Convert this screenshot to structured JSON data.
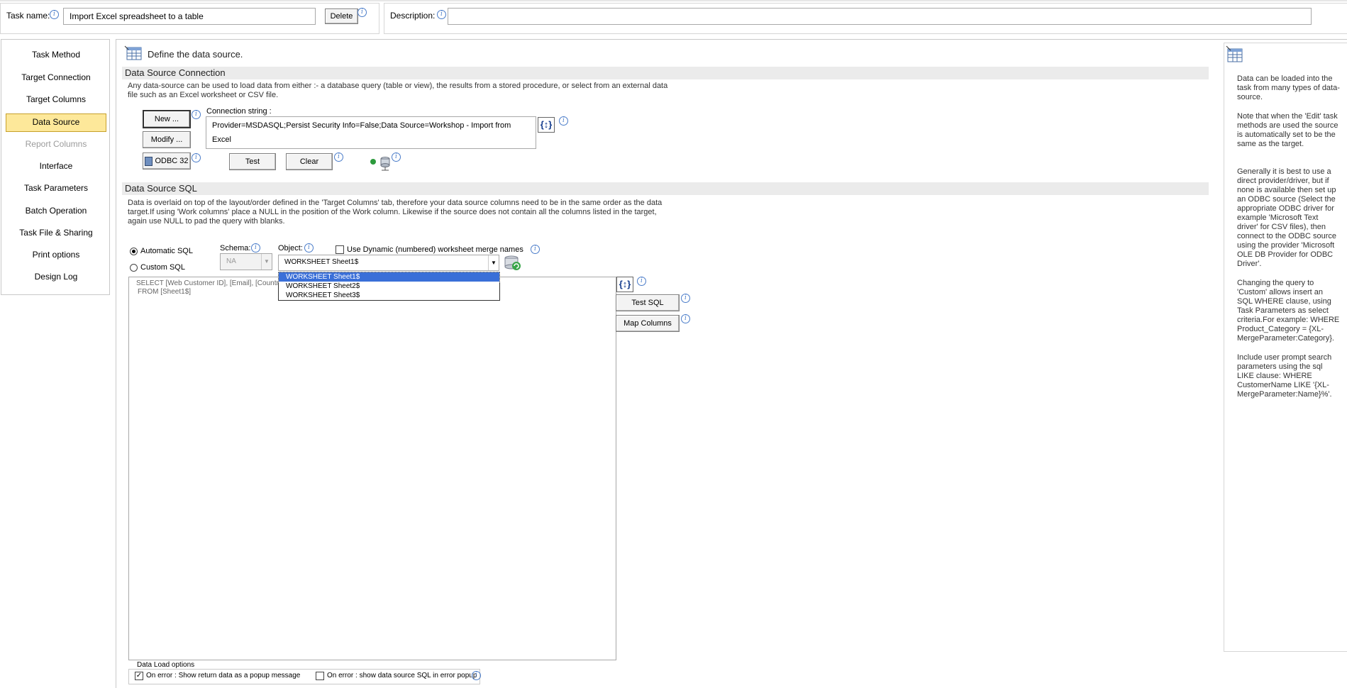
{
  "header": {
    "task_name_label": "Task name:",
    "task_name_value": "Import Excel spreadsheet to a table",
    "delete_label": "Delete",
    "description_label": "Description:",
    "description_value": ""
  },
  "nav": {
    "items": [
      {
        "label": "Task Method"
      },
      {
        "label": "Target Connection"
      },
      {
        "label": "Target Columns"
      },
      {
        "label": "Data Source"
      },
      {
        "label": "Report Columns"
      },
      {
        "label": "Interface"
      },
      {
        "label": "Task Parameters"
      },
      {
        "label": "Batch Operation"
      },
      {
        "label": "Task File & Sharing"
      },
      {
        "label": "Print options"
      },
      {
        "label": "Design Log"
      }
    ]
  },
  "main": {
    "heading": "Define the data source.",
    "connection": {
      "section_title": "Data Source Connection",
      "description_line1": "Any data-source can be used to load data from either :- a database query (table or view), the results from a stored procedure, or select from an external data",
      "description_line2": "file such as an Excel worksheet or CSV file.",
      "new_label": "New ...",
      "modify_label": "Modify ...",
      "odbc_label": "ODBC 32",
      "conn_string_label": "Connection string :",
      "conn_string_value": "Provider=MSDASQL;Persist Security Info=False;Data Source=Workshop - Import from Excel",
      "test_label": "Test",
      "clear_label": "Clear",
      "param_button": "{↕}"
    },
    "sql": {
      "section_title": "Data Source SQL",
      "description_line1": "Data is overlaid on top of the layout/order defined in the 'Target Columns' tab,  therefore your data source columns need to be in the same order as the data",
      "description_line2": "target.If using 'Work columns' place a NULL in the position of the Work column.  Likewise if the source does not contain all the columns listed in the target,",
      "description_line3": "again use NULL to pad the query with blanks.",
      "automatic_label": "Automatic SQL",
      "custom_label": "Custom SQL",
      "schema_label": "Schema:",
      "schema_value": "NA",
      "object_label": "Object:",
      "object_value": "WORKSHEET Sheet1$",
      "dynamic_label": "Use Dynamic (numbered) worksheet merge names",
      "dropdown_options": [
        "WORKSHEET Sheet1$",
        "WORKSHEET Sheet2$",
        "WORKSHEET Sheet3$"
      ],
      "sql_line1": "SELECT [Web Customer ID], [Email], [Country], [",
      "sql_line2": "FROM [Sheet1$]",
      "test_sql_label": "Test SQL",
      "map_columns_label": "Map Columns",
      "param_button": "{↕}"
    },
    "load_options": {
      "group_label": "Data Load options",
      "opt1_label": "On error : Show return data as a popup message",
      "opt1_checked": true,
      "opt2_label": "On error : show data source SQL in error popup",
      "opt2_checked": false
    }
  },
  "help": {
    "paragraphs": [
      "Data can be loaded into the task from many types of data-source.",
      "Note that when the 'Edit' task methods are used the source is automatically set to be the same as the target.",
      "Generally it is best to use a direct provider/driver, but if none is available then set up an ODBC source (Select the appropriate ODBC driver for example 'Microsoft Text driver' for CSV files), then connect to the ODBC source using the provider 'Microsoft OLE DB Provider for ODBC Driver'.",
      "Changing the query to 'Custom' allows insert an SQL WHERE clause, using Task Parameters as select criteria.For example: WHERE Product_Category = {XL-MergeParameter:Category}.",
      "Include user prompt search parameters using the sql LIKE clause: WHERE CustomerName LIKE '{XL-MergeParameter:Name}%'."
    ]
  },
  "colors": {
    "active_nav": "#fde89a",
    "section_bg": "#ebebeb",
    "info_blue": "#4a7cc9",
    "dropdown_selected": "#3a6fd8"
  }
}
